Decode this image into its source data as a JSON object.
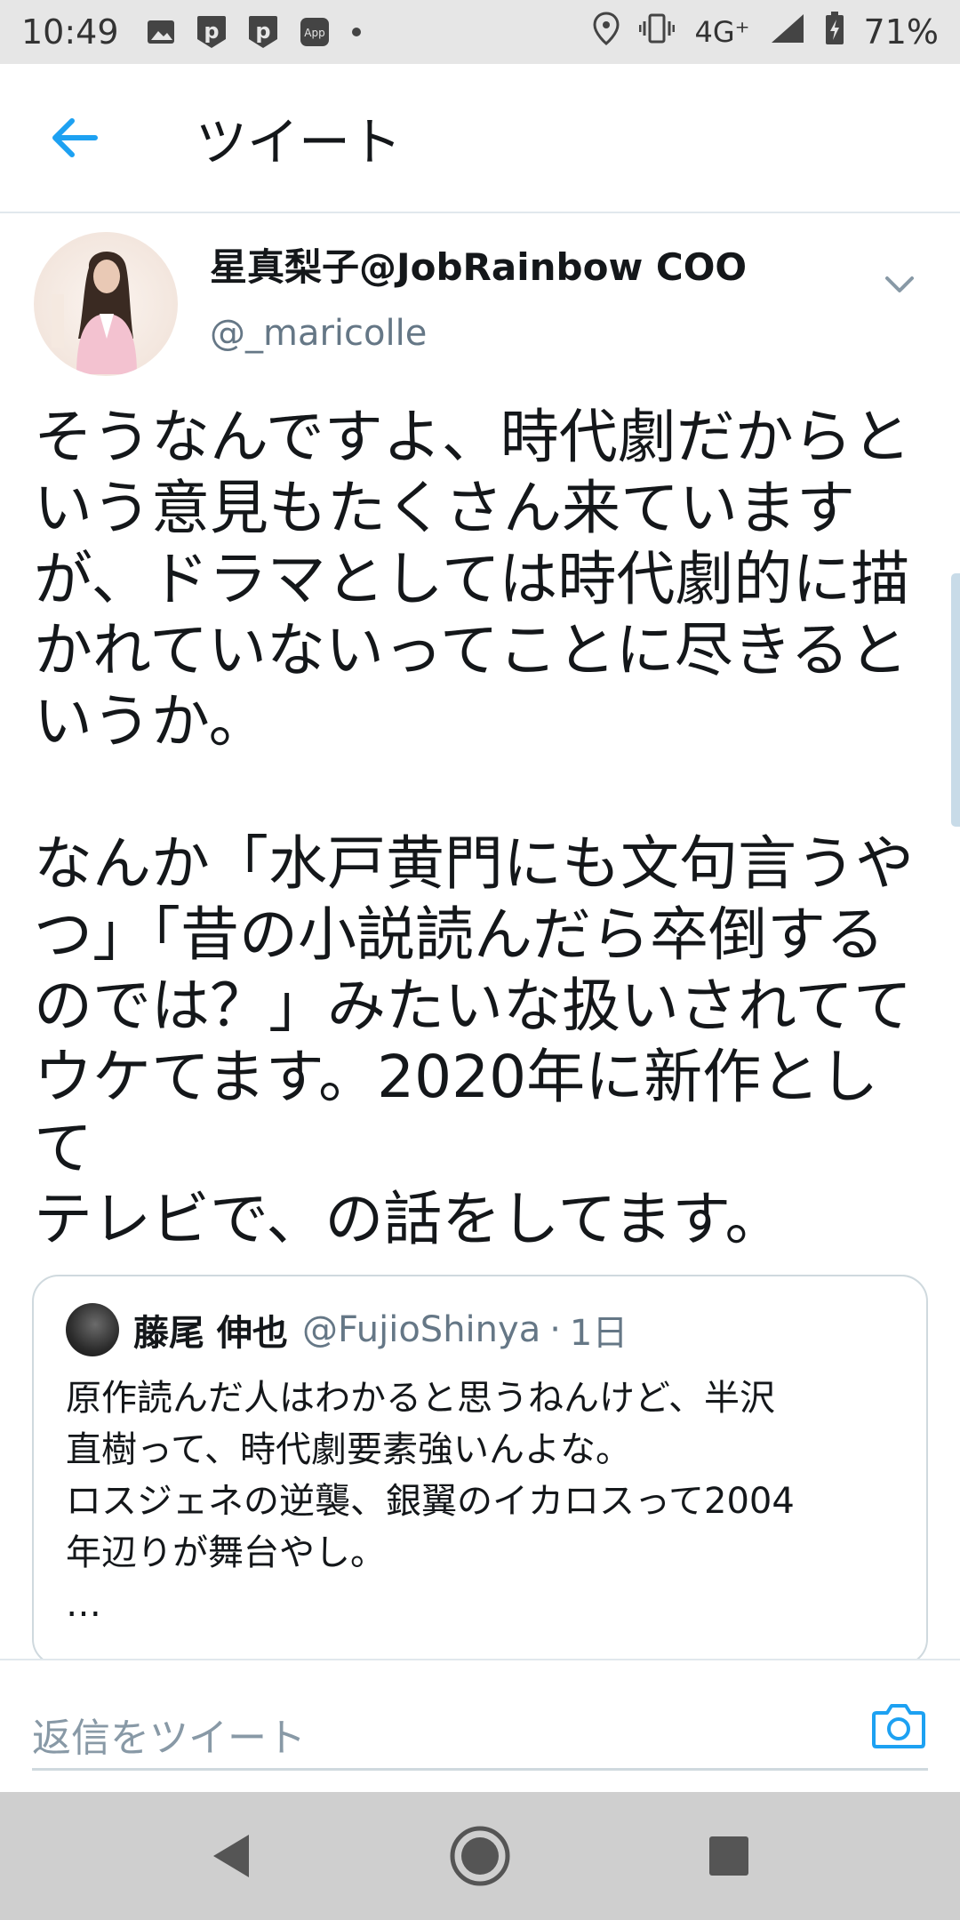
{
  "status_bar": {
    "time": "10:49",
    "network": "4G⁺",
    "battery": "71%",
    "icons": [
      "image-icon",
      "parking-icon",
      "parking-icon",
      "app-icon",
      "dot-icon",
      "location-icon",
      "vibrate-icon",
      "signal-icon",
      "battery-charging-icon"
    ]
  },
  "header": {
    "title": "ツイート",
    "back_icon": "back-arrow-icon"
  },
  "tweet": {
    "display_name": "星真梨子@JobRainbow COO",
    "username": "@_maricolle",
    "paragraphs": [
      [
        "そうなんですよ、時代劇だからと",
        "いう意見もたくさん来ています",
        "が、ドラマとしては時代劇的に描",
        "かれていないってことに尽きると",
        "いうか。"
      ],
      [
        "なんか「水戸黄門にも文句言うや",
        "つ」「昔の小説読んだら卒倒する",
        "のでは？」みたいな扱いされてて",
        "ウケてます。2020年に新作として",
        "テレビで、の話をしてます。"
      ]
    ]
  },
  "quote": {
    "name": "藤尾 伸也",
    "handle": "@FujioShinya",
    "separator": "·",
    "time": "1日",
    "lines": [
      "原作読んだ人はわかると思うねんけど、半沢",
      "直樹って、時代劇要素強いんよな。",
      "ロスジェネの逆襲、銀翼のイカロスって2004",
      "年辺りが舞台やし。",
      "…"
    ]
  },
  "reply": {
    "placeholder": "返信をツイート"
  },
  "colors": {
    "accent": "#1da1f2",
    "text": "#14171a",
    "secondary": "#657786",
    "border": "#e1e8ed"
  }
}
